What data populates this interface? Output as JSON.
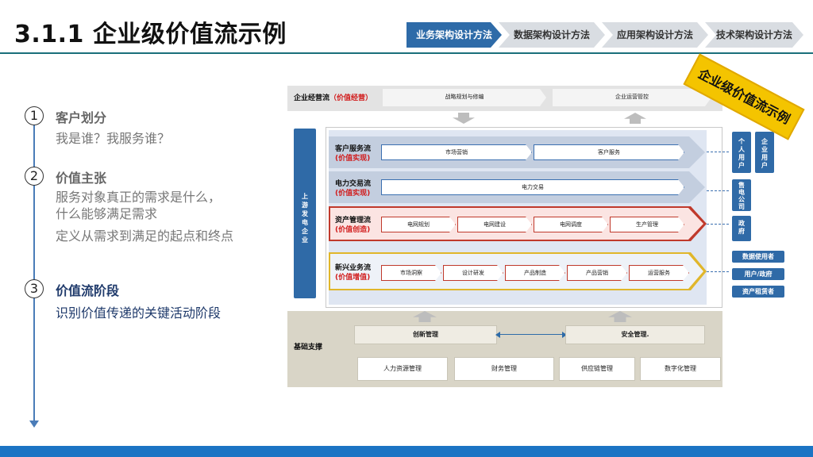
{
  "header": {
    "title": "3.1.1 企业级价值流示例",
    "breadcrumb": [
      "业务架构设计方法",
      "数据架构设计方法",
      "应用架构设计方法",
      "技术架构设计方法"
    ]
  },
  "left": {
    "steps": [
      {
        "num": "1",
        "title": "客户划分",
        "lines": [
          "我是谁？我服务谁？"
        ]
      },
      {
        "num": "2",
        "title": "价值主张",
        "lines": [
          "服务对象真正的需求是什么，",
          "什么能够满足需求",
          "定义从需求到满足的起点和终点"
        ]
      },
      {
        "num": "3",
        "title": "价值流阶段",
        "lines": [
          "识别价值传递的关键活动阶段"
        ]
      }
    ]
  },
  "diagram": {
    "badge": "企业级价值流示例",
    "top": {
      "label": "企业经营流",
      "tag": "（价值经营）",
      "left": "战略规划与修编",
      "right": "企业运营管控"
    },
    "upstream": "上游发电企业",
    "flows": [
      {
        "name": "客户服务流",
        "tag": "(价值实现)",
        "steps": [
          "市场营销",
          "客户服务"
        ]
      },
      {
        "name": "电力交易流",
        "tag": "(价值实现)",
        "steps": [
          "电力交易"
        ]
      },
      {
        "name": "资产管理流",
        "tag": "(价值创造)",
        "steps": [
          "电网规划",
          "电网建设",
          "电网调度",
          "生产管理"
        ]
      },
      {
        "name": "新兴业务流",
        "tag": "(价值增值)",
        "steps": [
          "市场洞察",
          "设计研发",
          "产品制造",
          "产品营销",
          "运营服务"
        ]
      }
    ],
    "right_targets": {
      "customer": [
        "个人用户",
        "企业用户"
      ],
      "trade": "售电公司",
      "asset": "政府",
      "emerging": [
        "数据使用者",
        "用户/政府",
        "资产租赁者"
      ]
    },
    "base": {
      "label": "基础支撑",
      "row1": [
        "创新管理",
        "安全管理."
      ],
      "row2": [
        "人力资源管理",
        "财务管理",
        "供应链管理",
        "数字化管理"
      ]
    }
  }
}
